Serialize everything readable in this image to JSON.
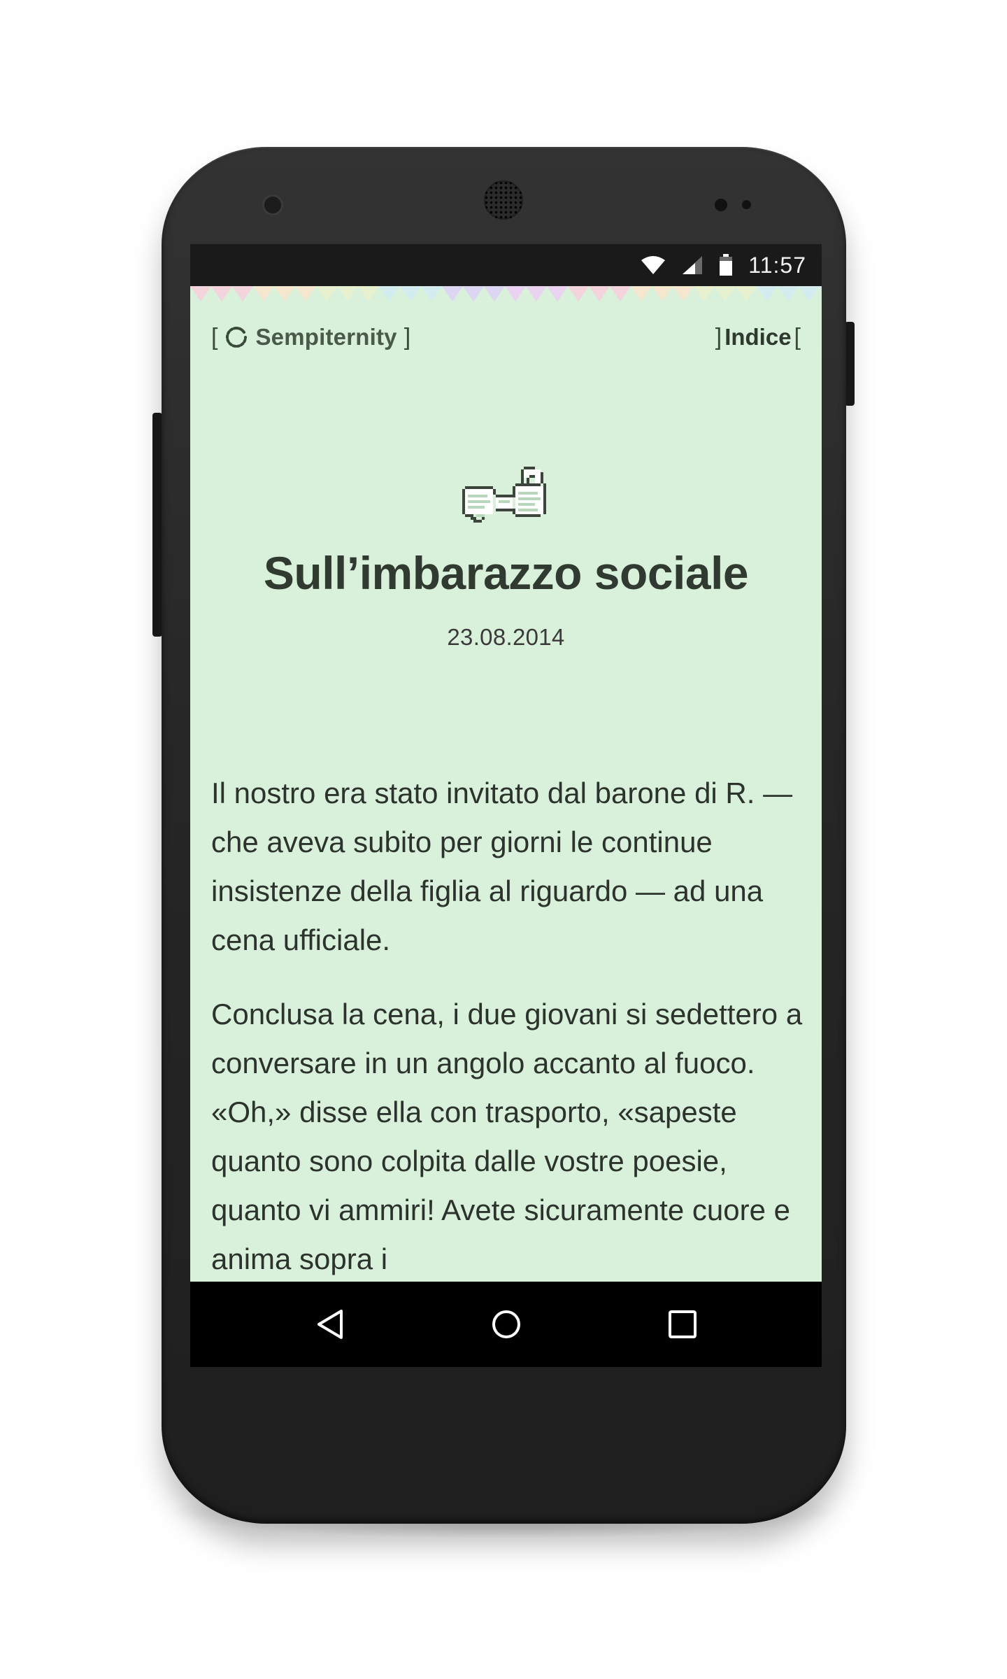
{
  "status_bar": {
    "time": "11:57",
    "icons": [
      "wifi-icon",
      "cellular-signal-icon",
      "battery-icon"
    ]
  },
  "header": {
    "brand_open_bracket": "[",
    "brand_label": "Sempiternity",
    "brand_close_bracket": "]",
    "brand_icon": "spinner-icon",
    "index_open_bracket": "]",
    "index_label": "Indice",
    "index_close_bracket": "["
  },
  "article": {
    "icon": "scroll-icon",
    "title": "Sull’imbarazzo sociale",
    "date": "23.08.2014",
    "paragraphs": [
      "Il nostro era stato invitato dal barone di R. — che aveva subito per giorni le continue insistenze della figlia al riguardo — ad una cena ufficiale.",
      "Conclusa la cena, i due giovani si sedettero a conversare in un angolo accanto al fuoco. «Oh,» disse ella con trasporto, «sapeste quanto sono colpita dalle vostre poesie, quanto vi ammiri! Avete sicuramente cuore e anima sopra i"
    ]
  },
  "navigation_bar": {
    "buttons": [
      "back-icon",
      "home-icon",
      "recent-apps-icon"
    ]
  },
  "colors": {
    "page_background": "#d9f0da",
    "text": "#2c332c",
    "status_bar": "#1a1a1a",
    "navigation_bar": "#000000"
  }
}
